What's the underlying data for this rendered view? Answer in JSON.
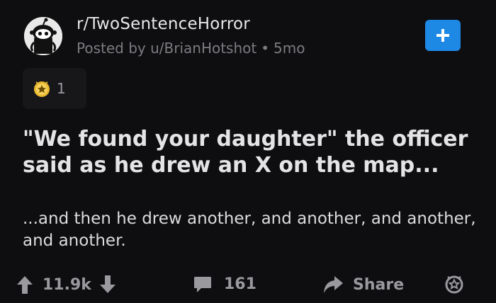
{
  "post": {
    "subreddit": "r/TwoSentenceHorror",
    "posted_by_prefix": "Posted by",
    "author": "u/BrianHotshot",
    "separator": "•",
    "age": "5mo",
    "join_icon": "plus-icon",
    "award": {
      "icon": "award-icon",
      "count": "1"
    },
    "title": "\"We found your daughter\" the officer said as he drew an X on the map...",
    "body": "...and then he drew another, and another, and another, and another.",
    "actions": {
      "upvote_icon": "arrow-up-icon",
      "score": "11.9k",
      "downvote_icon": "arrow-down-icon",
      "comment_icon": "comment-icon",
      "comments": "161",
      "share_icon": "share-icon",
      "share_label": "Share",
      "give_award_icon": "award-outline-icon"
    }
  },
  "colors": {
    "background": "#0e0e10",
    "join_button": "#1e88e5",
    "muted_text": "#9a9a9e"
  }
}
